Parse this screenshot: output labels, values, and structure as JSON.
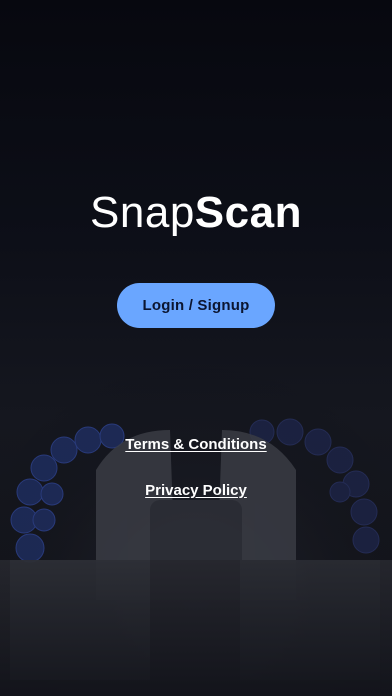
{
  "brand": {
    "light": "Snap",
    "bold": "Scan"
  },
  "actions": {
    "login_label": "Login / Signup"
  },
  "links": {
    "terms": "Terms & Conditions",
    "privacy": "Privacy Policy"
  },
  "colors": {
    "accent": "#6aa6ff",
    "background": "#0a0b12",
    "text": "#ffffff"
  }
}
